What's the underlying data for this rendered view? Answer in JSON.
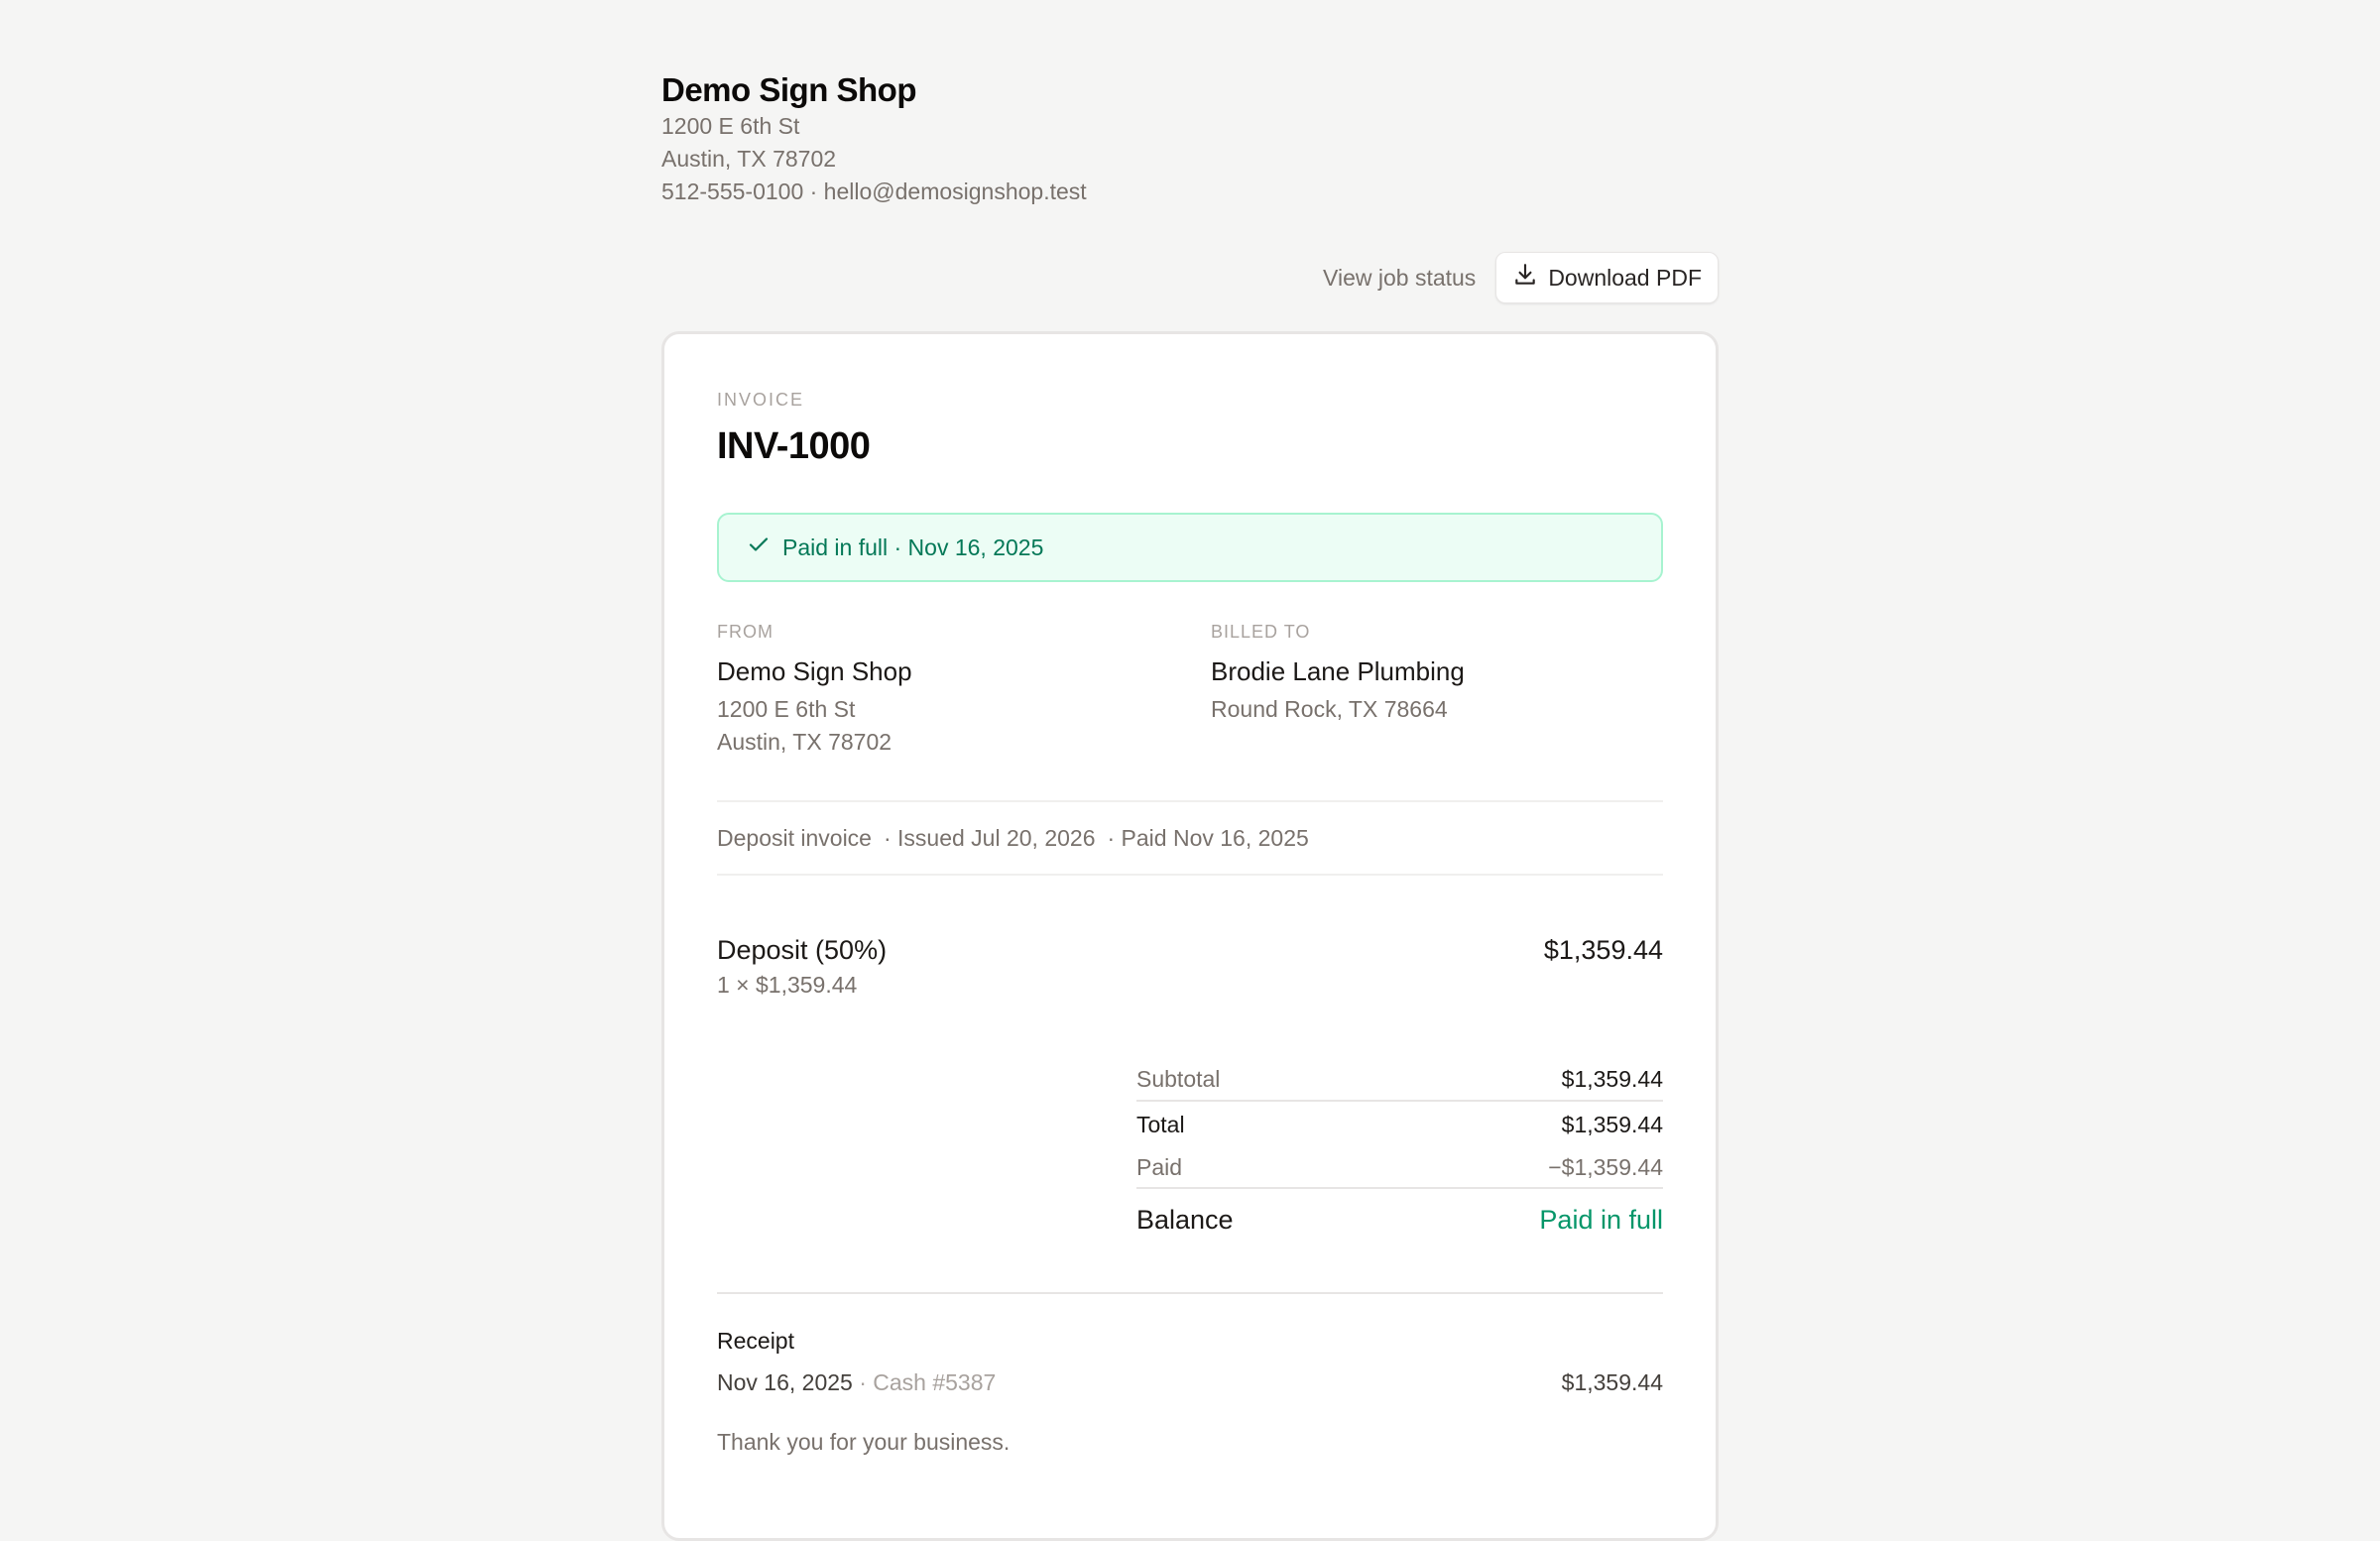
{
  "shop": {
    "name": "Demo Sign Shop",
    "address_line1": "1200 E 6th St",
    "address_line2": "Austin, TX 78702",
    "contact": "512-555-0100 · hello@demosignshop.test"
  },
  "actions": {
    "view_status_label": "View job status",
    "download_label": "Download PDF",
    "download_icon": "download-icon"
  },
  "invoice": {
    "label": "INVOICE",
    "number": "INV-1000",
    "status_banner": "Paid in full · Nov 16, 2025",
    "status_icon": "check-icon",
    "status_color": "#047857",
    "from": {
      "label": "FROM",
      "name": "Demo Sign Shop",
      "address_line1": "1200 E 6th St",
      "address_line2": "Austin, TX 78702"
    },
    "billed_to": {
      "label": "BILLED TO",
      "name": "Brodie Lane Plumbing",
      "address_line1": "Round Rock, TX 78664"
    },
    "meta": {
      "type": "Deposit invoice",
      "issued": "· Issued Jul 20, 2026",
      "paid": "· Paid Nov 16, 2025"
    },
    "line_items": [
      {
        "title": "Deposit (50%)",
        "detail": "1 × $1,359.44",
        "amount": "$1,359.44"
      }
    ],
    "totals": {
      "subtotal_label": "Subtotal",
      "subtotal": "$1,359.44",
      "total_label": "Total",
      "total": "$1,359.44",
      "paid_label": "Paid",
      "paid": "−$1,359.44",
      "balance_label": "Balance",
      "balance": "Paid in full",
      "balance_color": "#059669"
    },
    "receipt": {
      "heading": "Receipt",
      "date": "Nov 16, 2025",
      "method": " · Cash #5387",
      "amount": "$1,359.44"
    },
    "thanks": "Thank you for your business."
  }
}
